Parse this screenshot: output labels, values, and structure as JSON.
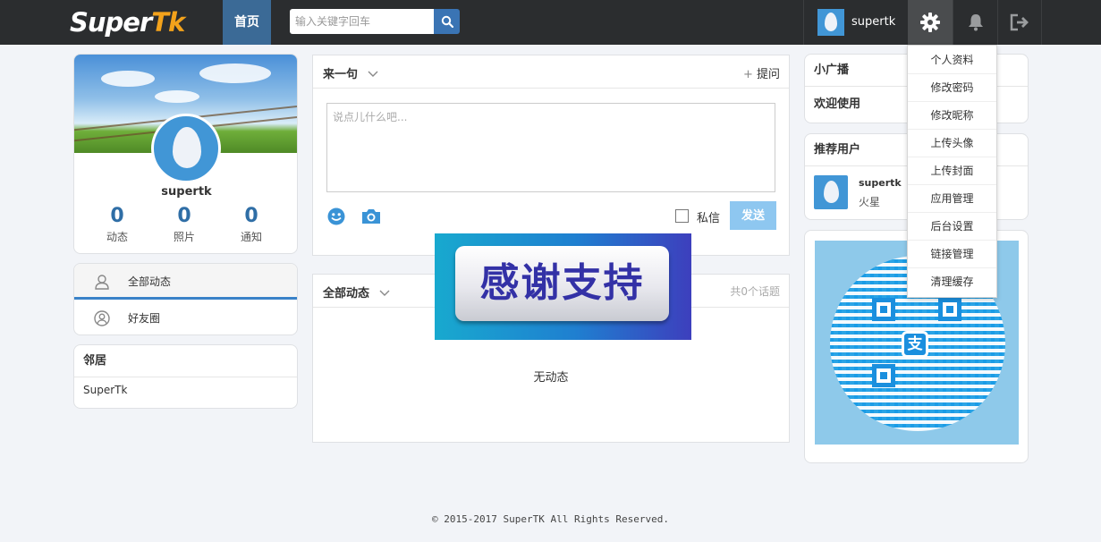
{
  "navbar": {
    "logo_main": "Super",
    "logo_accent": "Tk",
    "home_label": "首页",
    "search_placeholder": "输入关键字回车",
    "username": "supertk",
    "icons": [
      "search-icon",
      "gear-icon",
      "bell-icon",
      "logout-icon"
    ]
  },
  "profile": {
    "name": "supertk",
    "stats": [
      {
        "value": "0",
        "label": "动态"
      },
      {
        "value": "0",
        "label": "照片"
      },
      {
        "value": "0",
        "label": "通知"
      }
    ]
  },
  "left_nav": {
    "items": [
      {
        "label": "全部动态",
        "icon": "user-icon",
        "active": true
      },
      {
        "label": "好友圈",
        "icon": "user-circle-icon",
        "active": false
      }
    ]
  },
  "neighbors": {
    "title": "邻居",
    "items": [
      "SuperTk"
    ]
  },
  "composer": {
    "title": "来一句",
    "ask_label": "提问",
    "placeholder": "说点儿什么吧...",
    "private_label": "私信",
    "send_label": "发送"
  },
  "feed": {
    "title": "全部动态",
    "count_text": "共0个话题",
    "empty_text": "无动态"
  },
  "banner": {
    "text": "感谢支持"
  },
  "broadcast": {
    "title": "小广播",
    "line": "欢迎使用"
  },
  "recommend": {
    "title": "推荐用户",
    "users": [
      {
        "name": "supertk",
        "location": "火星"
      }
    ]
  },
  "qr": {
    "logo_text": "支"
  },
  "settings_menu": {
    "items": [
      "个人资料",
      "修改密码",
      "修改昵称",
      "上传头像",
      "上传封面",
      "应用管理",
      "后台设置",
      "链接管理",
      "清理缓存"
    ]
  },
  "footer": {
    "text": "© 2015-2017 SuperTK All Rights Reserved."
  },
  "colors": {
    "navbar_bg": "#2b2d2f",
    "home_bg": "#3b6a96",
    "accent_blue": "#3a82c8",
    "logo_accent": "#f3a21b",
    "stat_blue": "#2f6ea6",
    "send_disabled": "#8ec7f0"
  }
}
